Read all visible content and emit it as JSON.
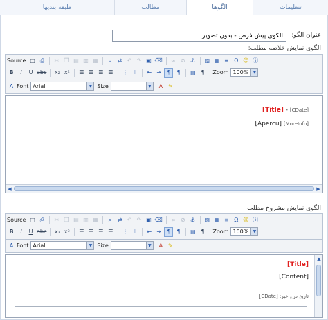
{
  "tabs": [
    {
      "label": "طبقه بندیها",
      "active": false
    },
    {
      "label": "مطالب",
      "active": false
    },
    {
      "label": "الگوها",
      "active": true
    },
    {
      "label": "تنظیمات",
      "active": false
    }
  ],
  "pattern_title": {
    "label": "عنوان الگو:",
    "value": "الگوی پیش فرض - بدون تصویر"
  },
  "summary_section": {
    "label": "الگوی نمایش خلاصه مطلب:"
  },
  "full_section": {
    "label": "الگوی نمایش مشروح مطلب:"
  },
  "toolbar": {
    "source_label": "Source",
    "font_label": "Font",
    "font_value": "Arial",
    "size_label": "Size",
    "size_value": "",
    "zoom_label": "Zoom",
    "zoom_value": "100%"
  },
  "summary_content": {
    "title_token": "[Title]",
    "separator": " - ",
    "cdate_token": "[CDate]",
    "apercu_token": "[Apercu]",
    "moreinfo_token": "[MoreInfo]"
  },
  "full_content": {
    "title_token": "[Title]",
    "content_token": "[Content]",
    "date_line": "تاریخ درج خبر: [CDate]"
  }
}
